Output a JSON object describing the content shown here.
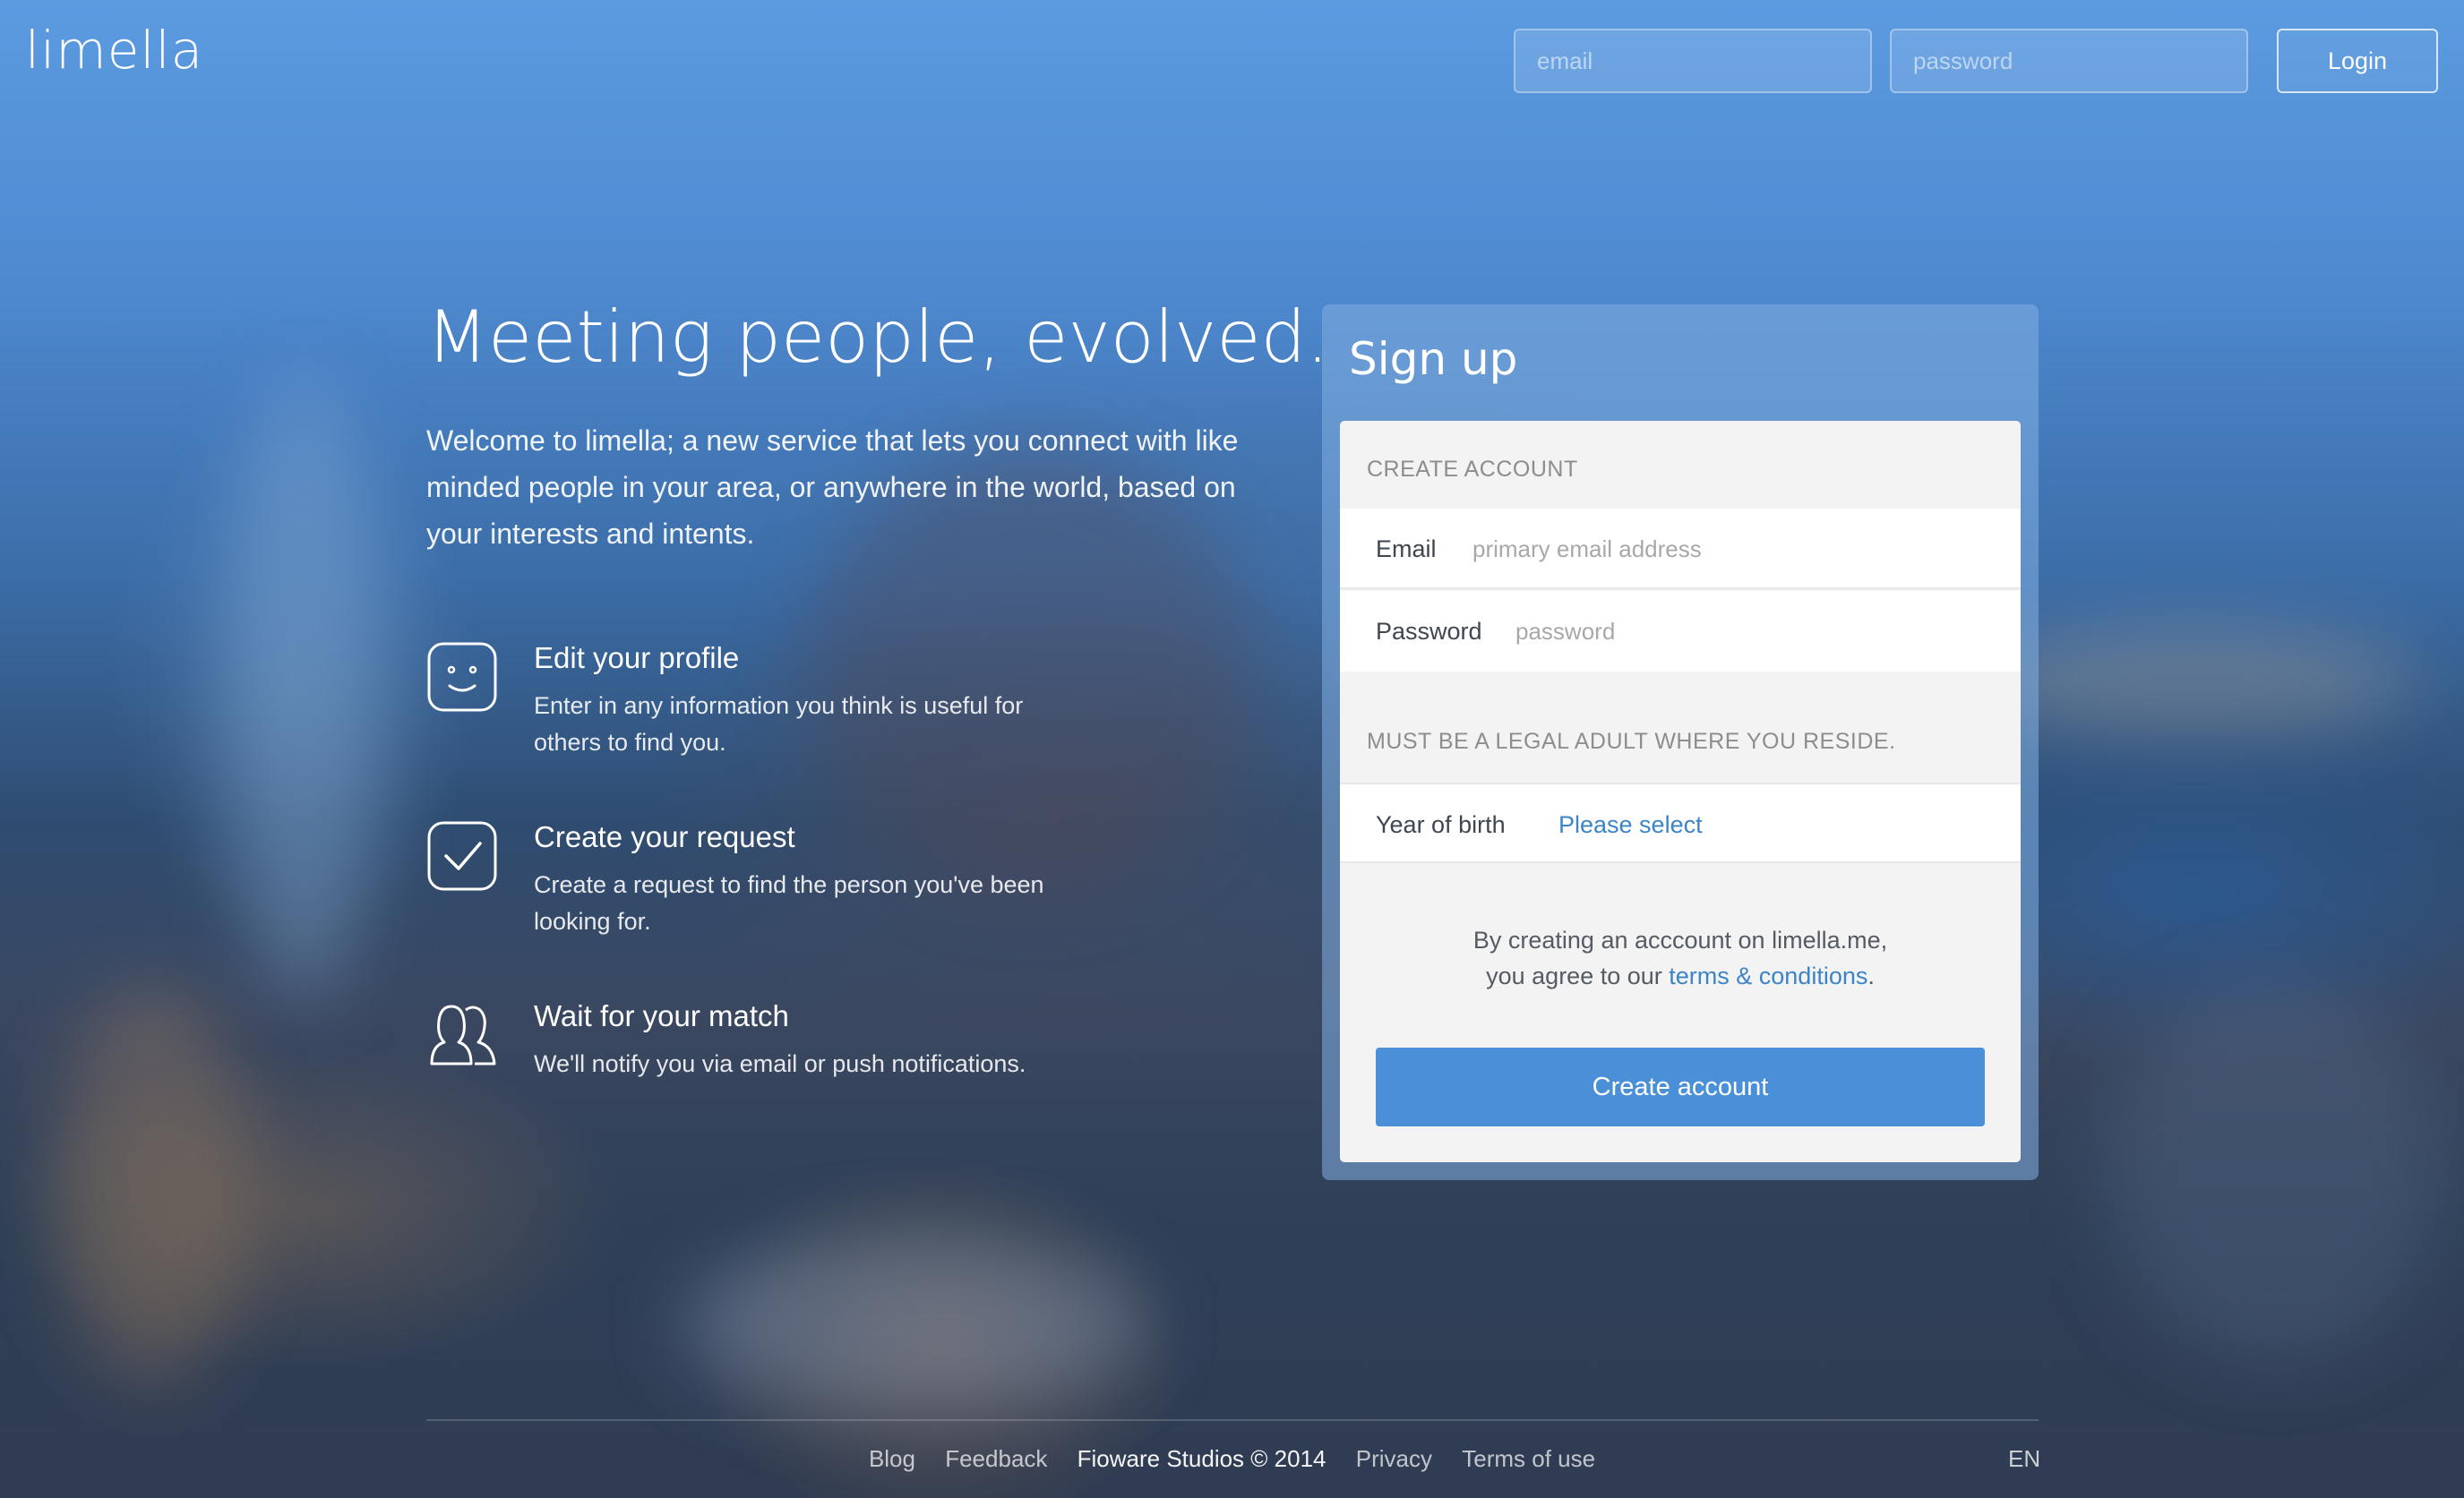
{
  "header": {
    "logo": "limella",
    "email_placeholder": "email",
    "password_placeholder": "password",
    "login_label": "Login"
  },
  "hero": {
    "title": "Meeting people, evolved.",
    "text": "Welcome to limella; a new service that lets you connect with like minded people in your area, or anywhere in the world, based on your interests and intents."
  },
  "features": [
    {
      "icon": "smiley-face-icon",
      "title": "Edit your profile",
      "description": "Enter in any information you think is useful for others to find you."
    },
    {
      "icon": "checkmark-icon",
      "title": "Create your request",
      "description": "Create a request to find the person you've been looking for."
    },
    {
      "icon": "people-icon",
      "title": "Wait for your match",
      "description": "We'll notify you via email or push notifications."
    }
  ],
  "signup": {
    "title": "Sign up",
    "create_account_heading": "CREATE ACCOUNT",
    "email_label": "Email",
    "email_placeholder": "primary email address",
    "password_label": "Password",
    "password_placeholder": "password",
    "legal_heading": "MUST BE A LEGAL ADULT WHERE YOU RESIDE.",
    "year_label": "Year of birth",
    "year_value": "Please select",
    "agree_line1": "By creating an acccount on limella.me,",
    "agree_line2_prefix": "you agree to our ",
    "terms_link": "terms & conditions",
    "agree_line2_suffix": ".",
    "create_button": "Create account"
  },
  "footer": {
    "links": [
      "Blog",
      "Feedback"
    ],
    "copyright": "Fioware Studios © 2014",
    "links_after": [
      "Privacy",
      "Terms of use"
    ],
    "language": "EN"
  },
  "colors": {
    "accent": "#4a90d9",
    "link": "#3c84c6",
    "card_bg": "#f3f3f3"
  }
}
